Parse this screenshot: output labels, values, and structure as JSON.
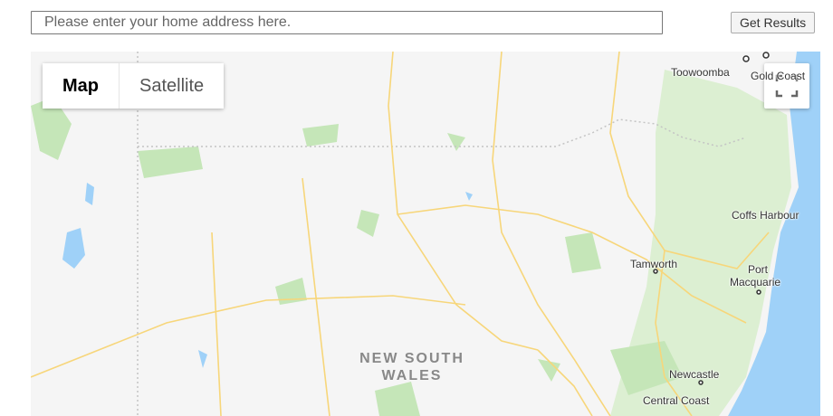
{
  "search": {
    "placeholder": "Please enter your home address here.",
    "button_label": "Get Results"
  },
  "map": {
    "type_controls": {
      "map_label": "Map",
      "satellite_label": "Satellite"
    },
    "fullscreen_icon": "fullscreen-icon",
    "labels": {
      "toowoomba": "Toowoomba",
      "gold_coast": "Gold Coast",
      "coffs_harbour": "Coffs Harbour",
      "tamworth": "Tamworth",
      "port_macquarie_1": "Port",
      "port_macquarie_2": "Macquarie",
      "newcastle": "Newcastle",
      "central_coast": "Central Coast",
      "region_1": "NEW SOUTH",
      "region_2": "WALES"
    },
    "colors": {
      "land": "#f5f5f5",
      "water": "#9fd1f8",
      "park": "#c5e6b8",
      "road": "#f7d67a"
    }
  }
}
